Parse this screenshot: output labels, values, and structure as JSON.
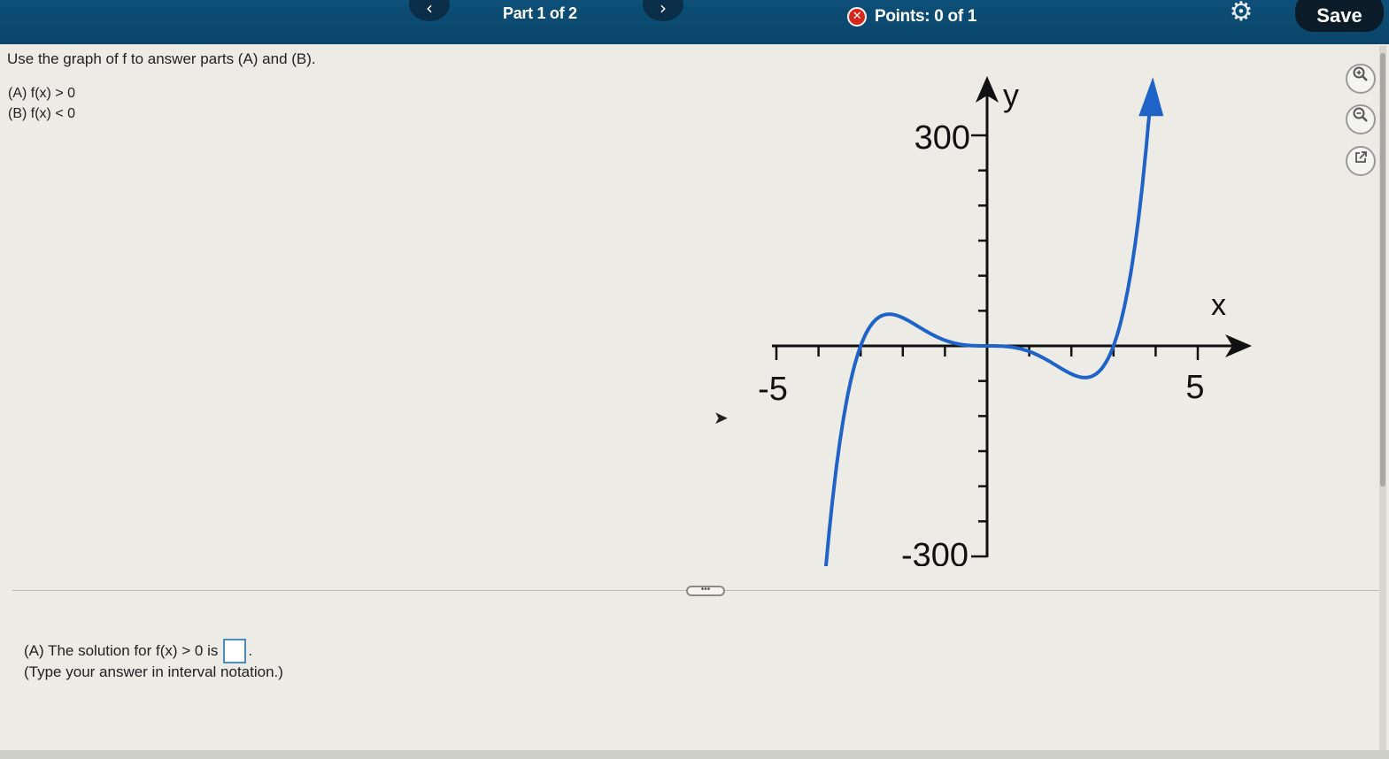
{
  "header": {
    "prev_icon": "chevron-left-icon",
    "prev_glyph": "‹",
    "next_icon": "chevron-right-icon",
    "next_glyph": "›",
    "part_label": "Part 1 of 2",
    "points_status_icon": "x-circle-icon",
    "points_status_glyph": "✕",
    "points_label": "Points: 0 of 1",
    "settings_icon": "gear-icon",
    "settings_glyph": "⚙",
    "save_label": "Save",
    "colors": {
      "bar": "#0d4f78",
      "error": "#d5281b",
      "save": "#0b1b27"
    }
  },
  "question": {
    "prompt": "Use the graph of f to answer parts (A) and (B).",
    "part_a": "(A) f(x) > 0",
    "part_b": "(B) f(x) < 0"
  },
  "tools": {
    "zoom_in_icon": "zoom-in-icon",
    "zoom_out_icon": "zoom-out-icon",
    "popout_icon": "popout-icon"
  },
  "graph": {
    "y_axis_label": "y",
    "x_axis_label": "x",
    "y_max_label": "300",
    "y_min_label": "-300",
    "x_min_label": "-5",
    "x_max_label": "5",
    "xlim": [
      -5,
      5
    ],
    "ylim": [
      -300,
      300
    ],
    "curve_color": "#1f63c7",
    "roots": [
      -3,
      0,
      3
    ],
    "formula": "f(x) = x^3 (x - 3)(x + 3)"
  },
  "answer": {
    "label": "(A) The solution for f(x) > 0 is",
    "period": ".",
    "hint": "(Type your answer in interval notation.)",
    "handle_glyph": "•••"
  }
}
